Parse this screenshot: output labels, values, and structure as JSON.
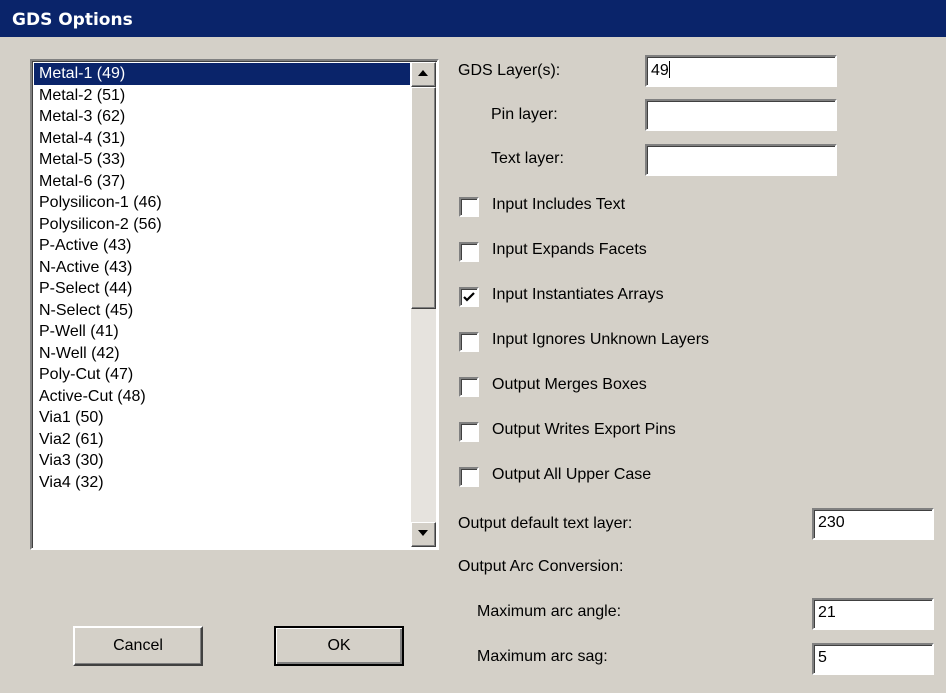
{
  "window": {
    "title": "GDS Options"
  },
  "layers": {
    "items": [
      "Metal-1 (49)",
      "Metal-2 (51)",
      "Metal-3 (62)",
      "Metal-4 (31)",
      "Metal-5 (33)",
      "Metal-6 (37)",
      "Polysilicon-1 (46)",
      "Polysilicon-2 (56)",
      "P-Active (43)",
      "N-Active (43)",
      "P-Select (44)",
      "N-Select (45)",
      "P-Well (41)",
      "N-Well (42)",
      "Poly-Cut (47)",
      "Active-Cut (48)",
      "Via1 (50)",
      "Via2 (61)",
      "Via3 (30)",
      "Via4 (32)"
    ],
    "selected": "Metal-1 (49)"
  },
  "fields": {
    "gds_layers_label": "GDS Layer(s):",
    "gds_layers_value": "49",
    "pin_layer_label": "Pin layer:",
    "pin_layer_value": "",
    "text_layer_label": "Text layer:",
    "text_layer_value": "",
    "output_default_text_layer_label": "Output default text layer:",
    "output_default_text_layer_value": "230",
    "arc_conversion_label": "Output Arc Conversion:",
    "max_arc_angle_label": "Maximum arc angle:",
    "max_arc_angle_value": "21",
    "max_arc_sag_label": "Maximum arc sag:",
    "max_arc_sag_value": "5"
  },
  "options": [
    {
      "label": "Input Includes Text",
      "checked": false
    },
    {
      "label": "Input Expands Facets",
      "checked": false
    },
    {
      "label": "Input Instantiates Arrays",
      "checked": true
    },
    {
      "label": "Input Ignores Unknown Layers",
      "checked": false
    },
    {
      "label": "Output Merges Boxes",
      "checked": false
    },
    {
      "label": "Output Writes Export Pins",
      "checked": false
    },
    {
      "label": "Output All Upper Case",
      "checked": false
    }
  ],
  "buttons": {
    "cancel": "Cancel",
    "ok": "OK"
  },
  "colors": {
    "face": "#d4d0c8",
    "selection": "#0a246a",
    "title_bar": "#0a246a"
  }
}
